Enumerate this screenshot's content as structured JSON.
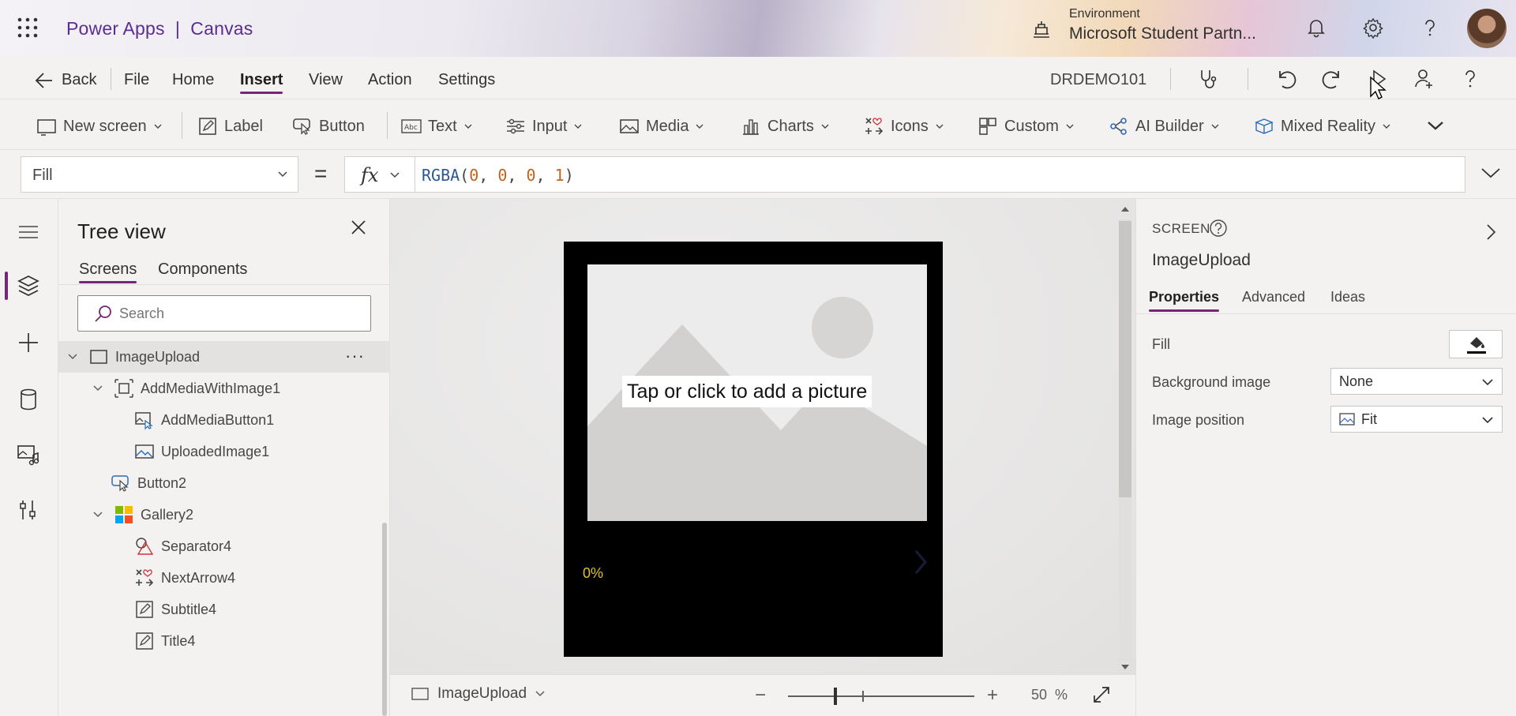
{
  "app": {
    "title": "Power Apps  |  Canvas"
  },
  "environment": {
    "label": "Environment",
    "name": "Microsoft Student Partn..."
  },
  "menu": {
    "back": "Back",
    "items": [
      "File",
      "Home",
      "Insert",
      "View",
      "Action",
      "Settings"
    ],
    "active": "Insert",
    "doc_name": "DRDEMO101"
  },
  "ribbon": {
    "new_screen": "New screen",
    "label": "Label",
    "button": "Button",
    "text": "Text",
    "input": "Input",
    "media": "Media",
    "charts": "Charts",
    "icons": "Icons",
    "custom": "Custom",
    "ai_builder": "AI Builder",
    "mixed_reality": "Mixed Reality"
  },
  "formula_bar": {
    "property": "Fill",
    "equals": "=",
    "fx": "fx",
    "formula": {
      "fn": "RGBA",
      "args": [
        "0",
        "0",
        "0",
        "1"
      ]
    }
  },
  "tree_view": {
    "title": "Tree view",
    "tabs": [
      "Screens",
      "Components"
    ],
    "active_tab": "Screens",
    "search_placeholder": "Search",
    "items": [
      {
        "name": "ImageUpload",
        "icon": "screen-icon",
        "level": 0,
        "expanded": true,
        "selected": true,
        "more": "···"
      },
      {
        "name": "AddMediaWithImage1",
        "icon": "group-icon",
        "level": 1,
        "expanded": true
      },
      {
        "name": "AddMediaButton1",
        "icon": "add-media-icon",
        "level": 2
      },
      {
        "name": "UploadedImage1",
        "icon": "image-icon",
        "level": 2
      },
      {
        "name": "Button2",
        "icon": "button-icon",
        "level": 1
      },
      {
        "name": "Gallery2",
        "icon": "gallery-icon",
        "level": 1,
        "expanded": true
      },
      {
        "name": "Separator4",
        "icon": "shapes-icon",
        "level": 2
      },
      {
        "name": "NextArrow4",
        "icon": "icons-icon",
        "level": 2
      },
      {
        "name": "Subtitle4",
        "icon": "label-icon",
        "level": 2
      },
      {
        "name": "Title4",
        "icon": "label-icon",
        "level": 2
      }
    ]
  },
  "canvas": {
    "add_picture_text": "Tap or click to add a picture",
    "progress_text": "0%",
    "screen_selector": "ImageUpload",
    "zoom": {
      "minus": "−",
      "plus": "+",
      "value": "50",
      "unit": "%"
    }
  },
  "properties": {
    "kind": "SCREEN",
    "name": "ImageUpload",
    "tabs": [
      "Properties",
      "Advanced",
      "Ideas"
    ],
    "active_tab": "Properties",
    "fill_label": "Fill",
    "fill_color": "#000000",
    "background_image_label": "Background image",
    "background_image_value": "None",
    "image_position_label": "Image position",
    "image_position_value": "Fit"
  },
  "colors": {
    "accent": "#742774",
    "brand_text": "#5c2d91",
    "progress": "#e3c326"
  }
}
